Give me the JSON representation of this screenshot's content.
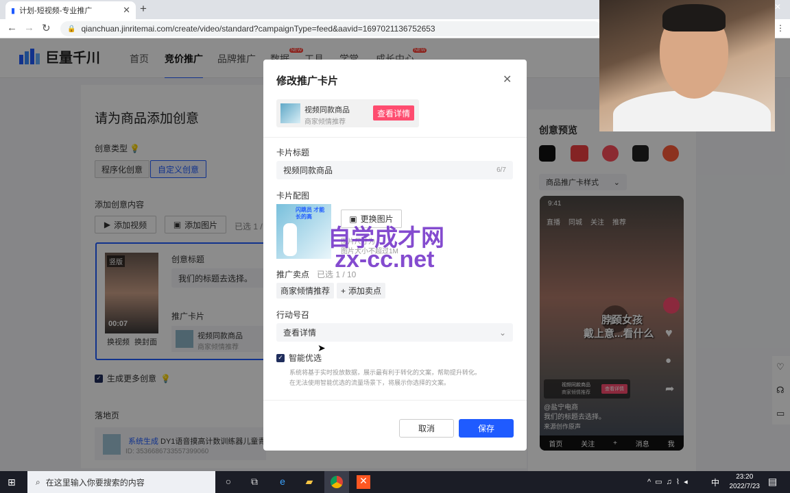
{
  "browser": {
    "tab_title": "计划-短视频-专业推广",
    "url": "qianchuan.jinritemai.com/create/video/standard?campaignType=feed&aavid=1697021136752653"
  },
  "header": {
    "brand": "巨量千川",
    "nav": [
      {
        "label": "首页"
      },
      {
        "label": "竞价推广",
        "active": true
      },
      {
        "label": "品牌推广"
      },
      {
        "label": "数据",
        "badge": "NEW"
      },
      {
        "label": "工具"
      },
      {
        "label": "学堂"
      },
      {
        "label": "成长中心",
        "badge": "NEW"
      }
    ]
  },
  "page": {
    "title": "请为商品添加创意",
    "creative_type_label": "创意类型",
    "creative_type_options": [
      "程序化创意",
      "自定义创意"
    ],
    "add_content_label": "添加创意内容",
    "add_video": "添加视频",
    "add_image": "添加图片",
    "selected_text": "已选 1 /",
    "video_badge": "竖版",
    "video_duration": "00:07",
    "change_video": "换视频",
    "change_cover": "换封面",
    "creative_title_label": "创意标题",
    "creative_title_value": "我们的标题去选择。",
    "promo_card_label": "推广卡片",
    "promo_card_title": "视频同款商品",
    "promo_card_sub": "商家倾情推荐",
    "generate_more": "生成更多创意",
    "landing_label": "落地页",
    "landing_source": "系统生成",
    "landing_title": "DY1语音摸高计数训练器儿童青",
    "landing_id": "ID: 3536686733557399060"
  },
  "preview": {
    "title": "创意预览",
    "style_select": "商品推广卡样式",
    "time": "9:41",
    "top_tabs": [
      "直播",
      "同城",
      "关注",
      "推荐"
    ],
    "overlay_text_1": "脖颈女孩",
    "overlay_text_2": "戴上意...看什么",
    "card_title": "视频同款商品",
    "card_sub": "商家倾情推荐",
    "card_btn": "查看详情",
    "account": "@盐宁电商",
    "caption": "我们的标题去选择。",
    "music": "来源创作原声",
    "bottom_tabs": [
      "首页",
      "关注",
      "+",
      "消息",
      "我"
    ]
  },
  "modal": {
    "title": "修改推广卡片",
    "preview_title": "视频同款商品",
    "preview_sub": "商家倾情推荐",
    "preview_btn": "查看详情",
    "card_title_label": "卡片标题",
    "card_title_value": "视频同款商品",
    "card_title_count": "6/7",
    "card_image_label": "卡片配图",
    "change_image": "更换图片",
    "image_hint_1": "图片尺寸为 ",
    "image_hint_2": "图片大小不超过1M",
    "selling_points_label": "推广卖点",
    "selling_points_count": "已选 1 / 10",
    "selling_point_tag": "商家倾情推荐",
    "add_selling_point": "添加卖点",
    "cta_label": "行动号召",
    "cta_value": "查看详情",
    "smart_label": "智能优选",
    "smart_desc_1": "系统将基于实时投放数据，展示最有利于转化的文案，帮助提升转化。",
    "smart_desc_2": "在无法使用智能优选的流量场景下，将展示你选择的文案。",
    "cancel": "取消",
    "save": "保存",
    "thumb_text": "闪跳员 才能长的高"
  },
  "watermark": {
    "line1": "自学成才网",
    "line2": "zx-cc.net"
  },
  "taskbar": {
    "search_placeholder": "在这里输入你要搜索的内容",
    "time": "23:20",
    "date": "2022/7/23",
    "ime": "中"
  },
  "colors": {
    "primary": "#1f5bff",
    "pink": "#fe4c6f",
    "watermark": "#6f2cc7"
  }
}
